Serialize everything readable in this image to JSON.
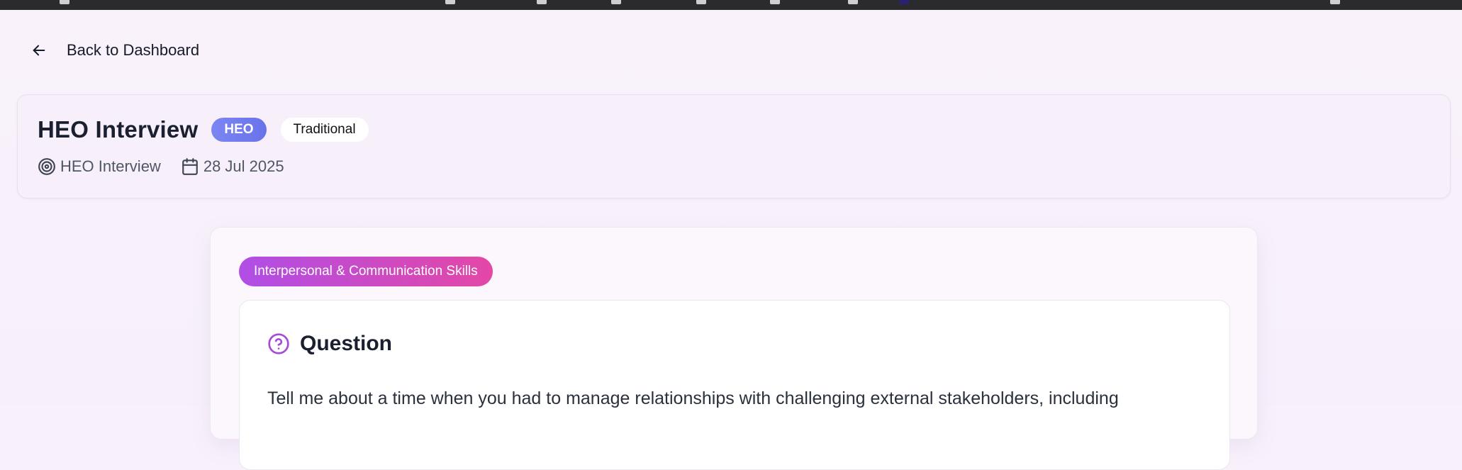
{
  "nav": {
    "back_label": "Back to Dashboard"
  },
  "header": {
    "title": "HEO Interview",
    "level_badge": "HEO",
    "type_badge": "Traditional",
    "meta": {
      "interview_name": "HEO Interview",
      "date": "28 Jul 2025"
    }
  },
  "question": {
    "category": "Interpersonal & Communication Skills",
    "heading": "Question",
    "text": "Tell me about a time when you had to manage relationships with challenging external stakeholders, including"
  },
  "colors": {
    "page_bg": "#f8f1fb",
    "level_badge": "#6f7aee",
    "category_gradient_start": "#b04ee6",
    "category_gradient_end": "#e447a6",
    "question_icon": "#a64ad8"
  },
  "icons": {
    "back": "arrow-left-icon",
    "meta_interview": "target-icon",
    "meta_date": "calendar-icon",
    "question": "question-circle-icon"
  }
}
